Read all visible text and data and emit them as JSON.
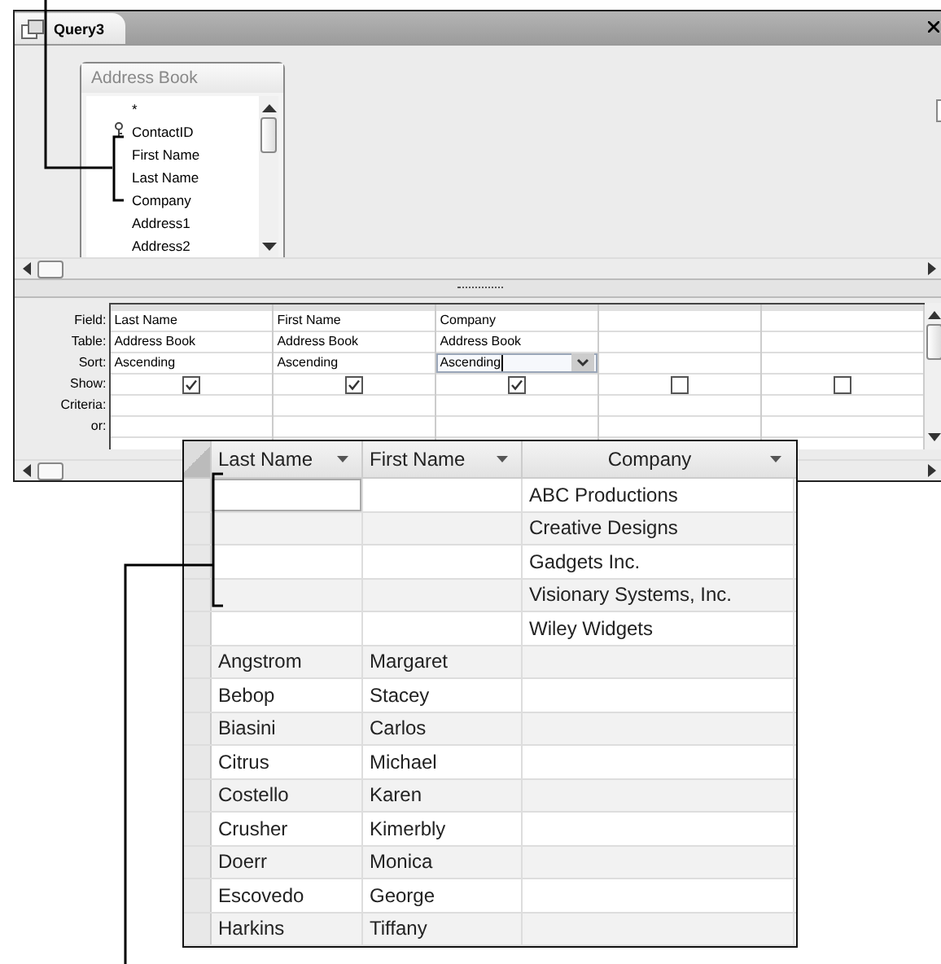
{
  "window": {
    "title": "Query3"
  },
  "table_box": {
    "title": "Address Book",
    "fields": [
      {
        "name": "*",
        "key": false
      },
      {
        "name": "ContactID",
        "key": true
      },
      {
        "name": "First Name",
        "key": false
      },
      {
        "name": "Last Name",
        "key": false
      },
      {
        "name": "Company",
        "key": false
      },
      {
        "name": "Address1",
        "key": false
      },
      {
        "name": "Address2",
        "key": false
      }
    ]
  },
  "design_grid": {
    "row_labels": [
      "Field:",
      "Table:",
      "Sort:",
      "Show:",
      "Criteria:",
      "or:"
    ],
    "columns": [
      {
        "field": "Last Name",
        "table": "Address Book",
        "sort": "Ascending",
        "show": true,
        "selected": false
      },
      {
        "field": "First Name",
        "table": "Address Book",
        "sort": "Ascending",
        "show": true,
        "selected": false
      },
      {
        "field": "Company",
        "table": "Address Book",
        "sort": "Ascending",
        "show": true,
        "selected": true
      },
      {
        "show": false,
        "selected": false
      },
      {
        "show": false,
        "selected": false
      }
    ]
  },
  "datasheet": {
    "columns": [
      "Last Name",
      "First Name",
      "Company"
    ],
    "rows": [
      {
        "cells": [
          "",
          "",
          "ABC Productions"
        ],
        "selected": true
      },
      {
        "cells": [
          "",
          "",
          "Creative Designs"
        ],
        "selected": false
      },
      {
        "cells": [
          "",
          "",
          "Gadgets Inc."
        ],
        "selected": false
      },
      {
        "cells": [
          "",
          "",
          "Visionary Systems, Inc."
        ],
        "selected": false
      },
      {
        "cells": [
          "",
          "",
          "Wiley Widgets"
        ],
        "selected": false
      },
      {
        "cells": [
          "Angstrom",
          "Margaret",
          ""
        ],
        "selected": false
      },
      {
        "cells": [
          "Bebop",
          "Stacey",
          ""
        ],
        "selected": false
      },
      {
        "cells": [
          "Biasini",
          "Carlos",
          ""
        ],
        "selected": false
      },
      {
        "cells": [
          "Citrus",
          "Michael",
          ""
        ],
        "selected": false
      },
      {
        "cells": [
          "Costello",
          "Karen",
          ""
        ],
        "selected": false
      },
      {
        "cells": [
          "Crusher",
          "Kimerbly",
          ""
        ],
        "selected": false
      },
      {
        "cells": [
          "Doerr",
          "Monica",
          ""
        ],
        "selected": false
      },
      {
        "cells": [
          "Escovedo",
          "George",
          ""
        ],
        "selected": false
      },
      {
        "cells": [
          "Harkins",
          "Tiffany",
          ""
        ],
        "selected": false
      }
    ]
  }
}
